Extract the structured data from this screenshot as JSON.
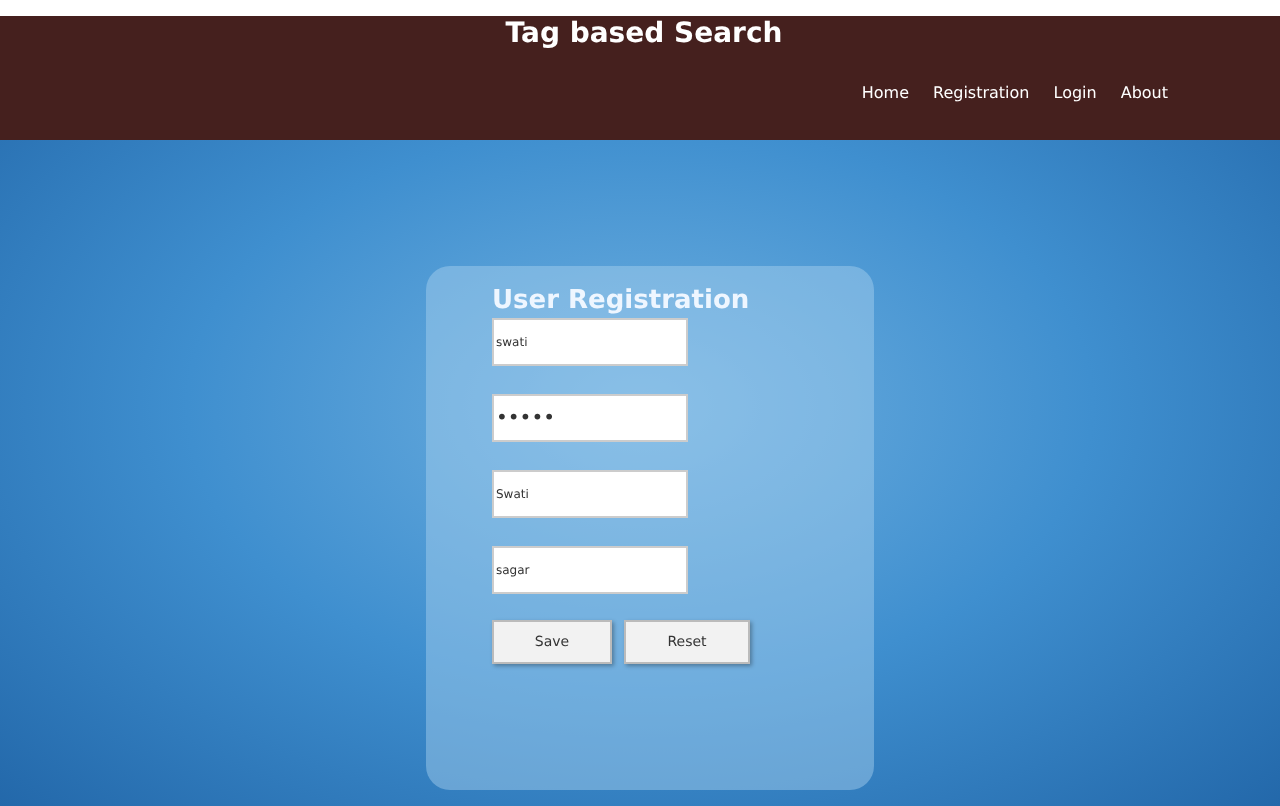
{
  "header": {
    "title": "Tag based Search",
    "nav": [
      {
        "label": "Home"
      },
      {
        "label": "Registration"
      },
      {
        "label": "Login"
      },
      {
        "label": "About"
      }
    ]
  },
  "form": {
    "title": "User Registration",
    "fields": [
      {
        "value": "swati"
      },
      {
        "value": "•••••"
      },
      {
        "value": "Swati"
      },
      {
        "value": "sagar"
      }
    ],
    "buttons": [
      {
        "label": "Save"
      },
      {
        "label": "Reset"
      }
    ]
  }
}
